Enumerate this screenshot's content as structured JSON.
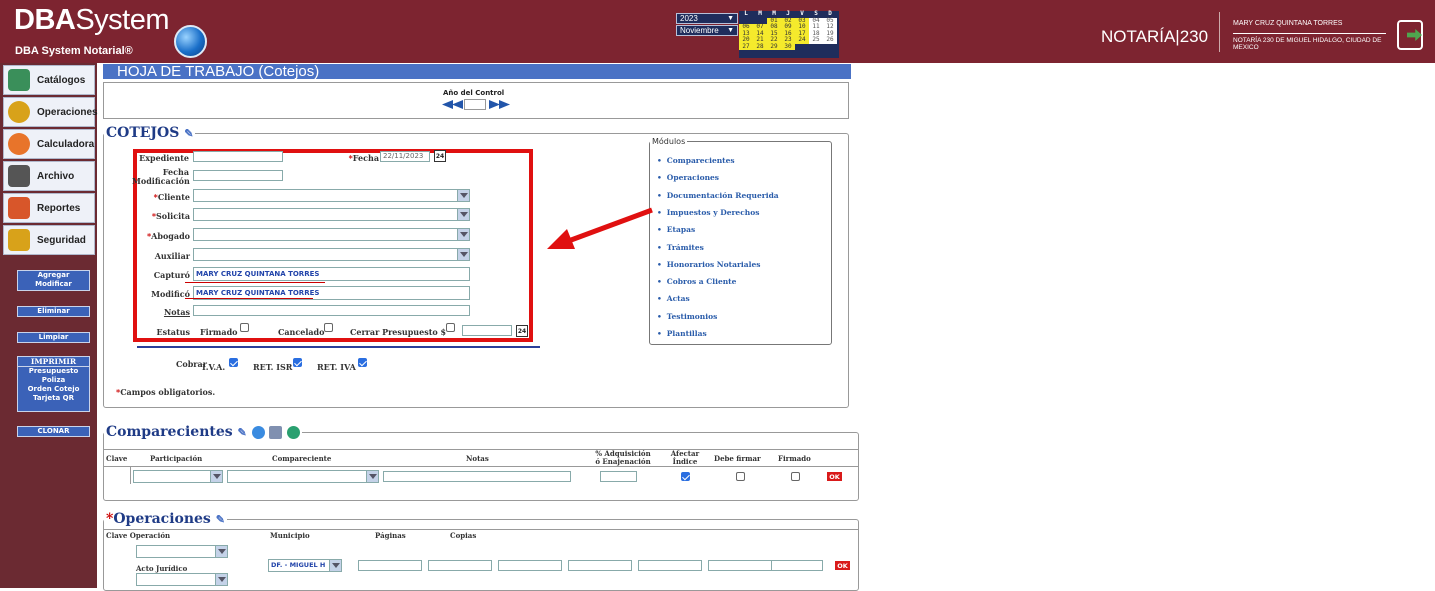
{
  "header": {
    "logo_bold": "DBA",
    "logo_light": "System",
    "logo_sub": "DBA System Notarial®",
    "year": "2023",
    "month": "Noviembre",
    "calendar": {
      "days_header": [
        "L",
        "M",
        "M",
        "J",
        "V",
        "S",
        "D"
      ],
      "rows": [
        [
          "",
          "",
          "01",
          "02",
          "03",
          "04",
          "05"
        ],
        [
          "06",
          "07",
          "08",
          "09",
          "10",
          "11",
          "12"
        ],
        [
          "13",
          "14",
          "15",
          "16",
          "17",
          "18",
          "19"
        ],
        [
          "20",
          "21",
          "22",
          "23",
          "24",
          "25",
          "26"
        ],
        [
          "27",
          "28",
          "29",
          "30",
          "",
          "",
          ""
        ]
      ]
    },
    "notaria": "NOTARÍA|230",
    "user_name": "MARY CRUZ QUINTANA TORRES",
    "user_address": "NOTARÍA 230 DE MIGUEL HIDALGO, CIUDAD DE MEXICO"
  },
  "sidebar": {
    "nav": [
      {
        "label": "Catálogos",
        "icon": "books-icon",
        "color": "#3a8f5a"
      },
      {
        "label": "Operaciones",
        "icon": "coins-icon",
        "color": "#d8a21a"
      },
      {
        "label": "Calculadora",
        "icon": "calculator-icon",
        "color": "#e8742a"
      },
      {
        "label": "Archivo",
        "icon": "folder-icon",
        "color": "#555555"
      },
      {
        "label": "Reportes",
        "icon": "reports-icon",
        "color": "#d8562a"
      },
      {
        "label": "Seguridad",
        "icon": "lock-icon",
        "color": "#d8a21a"
      }
    ],
    "agregar": "Agregar",
    "modificar": "Modificar",
    "eliminar": "Eliminar",
    "limpiar": "Limpiar",
    "imprimir": "IMPRIMIR",
    "presupuesto": "Presupuesto",
    "poliza": "Poliza",
    "orden_cotejo": "Orden Cotejo",
    "tarjeta_qr": "Tarjeta QR",
    "clonar": "CLONAR"
  },
  "page_title": "HOJA DE TRABAJO (Cotejos)",
  "control": {
    "label": "Año del Control"
  },
  "cotejos": {
    "legend": "COTEJOS",
    "expediente": "Expediente",
    "fecha": "Fecha",
    "fecha_value": "22/11/2023",
    "fecha_mod": "Fecha Modificación",
    "cliente": "Cliente",
    "solicita": "Solicita",
    "abogado": "Abogado",
    "auxiliar": "Auxiliar",
    "capturo": "Capturó",
    "capturo_value": "MARY CRUZ QUINTANA TORRES",
    "modifico": "Modificó",
    "modifico_value": "MARY CRUZ QUINTANA TORRES",
    "notas": "Notas",
    "estatus": "Estatus",
    "firmado": "Firmado",
    "cancelado": "Cancelado",
    "cerrar_presupuesto": "Cerrar Presupuesto $",
    "cobrar": "Cobrar",
    "iva": "I.V.A.",
    "ret_isr": "RET. ISR",
    "ret_iva": "RET. IVA",
    "campos_obligatorios": "Campos obligatorios.",
    "cal_day": "24"
  },
  "modulos": {
    "legend": "Módulos",
    "items": [
      "Comparecientes",
      "Operaciones",
      "Documentación Requerida",
      "Impuestos y Derechos",
      "Etapas",
      "Trámites",
      "Honorarios Notariales",
      "Cobros a Cliente",
      "Actas",
      "Testimonios",
      "Plantillas"
    ]
  },
  "comparecientes": {
    "legend": "Comparecientes",
    "headers": {
      "clave": "Clave",
      "participacion": "Participación",
      "compareciente": "Compareciente",
      "notas": "Notas",
      "adquisicion": "% Adquisición ó Enajenación",
      "afectar": "Afectar Índice",
      "debe_firmar": "Debe firmar",
      "firmado": "Firmado"
    },
    "ok": "OK"
  },
  "operaciones": {
    "legend": "Operaciones",
    "headers": {
      "clave_operacion": "Clave Operación",
      "municipio": "Municipio",
      "paginas": "Páginas",
      "copias": "Copias",
      "acto": "Acto Jurídico"
    },
    "municipio_value": "DF. - MIGUEL H",
    "ok": "OK"
  }
}
